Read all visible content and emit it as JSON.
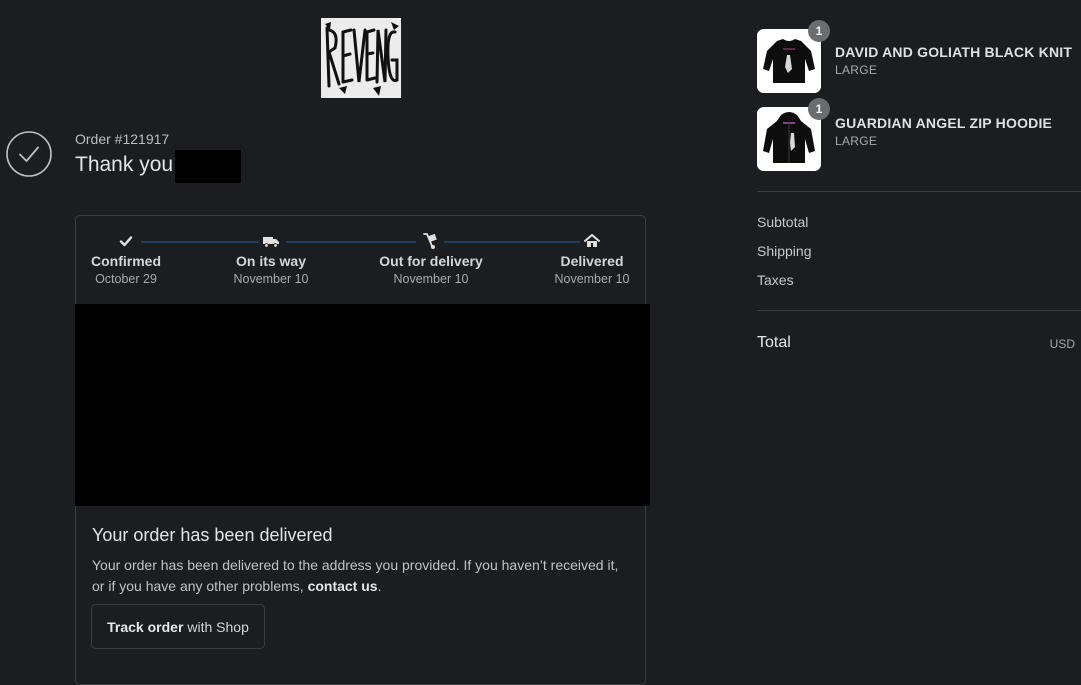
{
  "brand": {
    "logo_icon": "revenge-logo",
    "logo_text": "Revenge"
  },
  "order": {
    "number": "Order #121917",
    "thanks": "Thank you"
  },
  "tracking": {
    "steps": [
      {
        "label": "Confirmed",
        "date": "October 29",
        "icon": "check-icon"
      },
      {
        "label": "On its way",
        "date": "November 10",
        "icon": "truck-icon"
      },
      {
        "label": "Out for delivery",
        "date": "November 10",
        "icon": "hand-truck-icon"
      },
      {
        "label": "Delivered",
        "date": "November 10",
        "icon": "home-icon"
      }
    ],
    "status_title": "Your order has been delivered",
    "status_text": "Your order has been delivered to the address you provided. If you haven’t received it, or if you have any other problems,",
    "contact_link": "contact us",
    "status_text_end": ".",
    "track_button_bold": "Track order",
    "track_button_rest": "with Shop"
  },
  "cart": {
    "items": [
      {
        "name": "DAVID AND GOLIATH BLACK KNIT",
        "variant": "LARGE",
        "quantity": "1",
        "thumb_icon": "black-knit-sweater-icon"
      },
      {
        "name": "GUARDIAN ANGEL ZIP HOODIE",
        "variant": "LARGE",
        "quantity": "1",
        "thumb_icon": "zip-hoodie-icon"
      }
    ],
    "summary": {
      "subtotal_label": "Subtotal",
      "shipping_label": "Shipping",
      "taxes_label": "Taxes",
      "total_label": "Total",
      "currency": "USD"
    }
  },
  "colors": {
    "background": "#1c1d20",
    "progress": "#1f3f63",
    "border": "#3b3c40"
  }
}
